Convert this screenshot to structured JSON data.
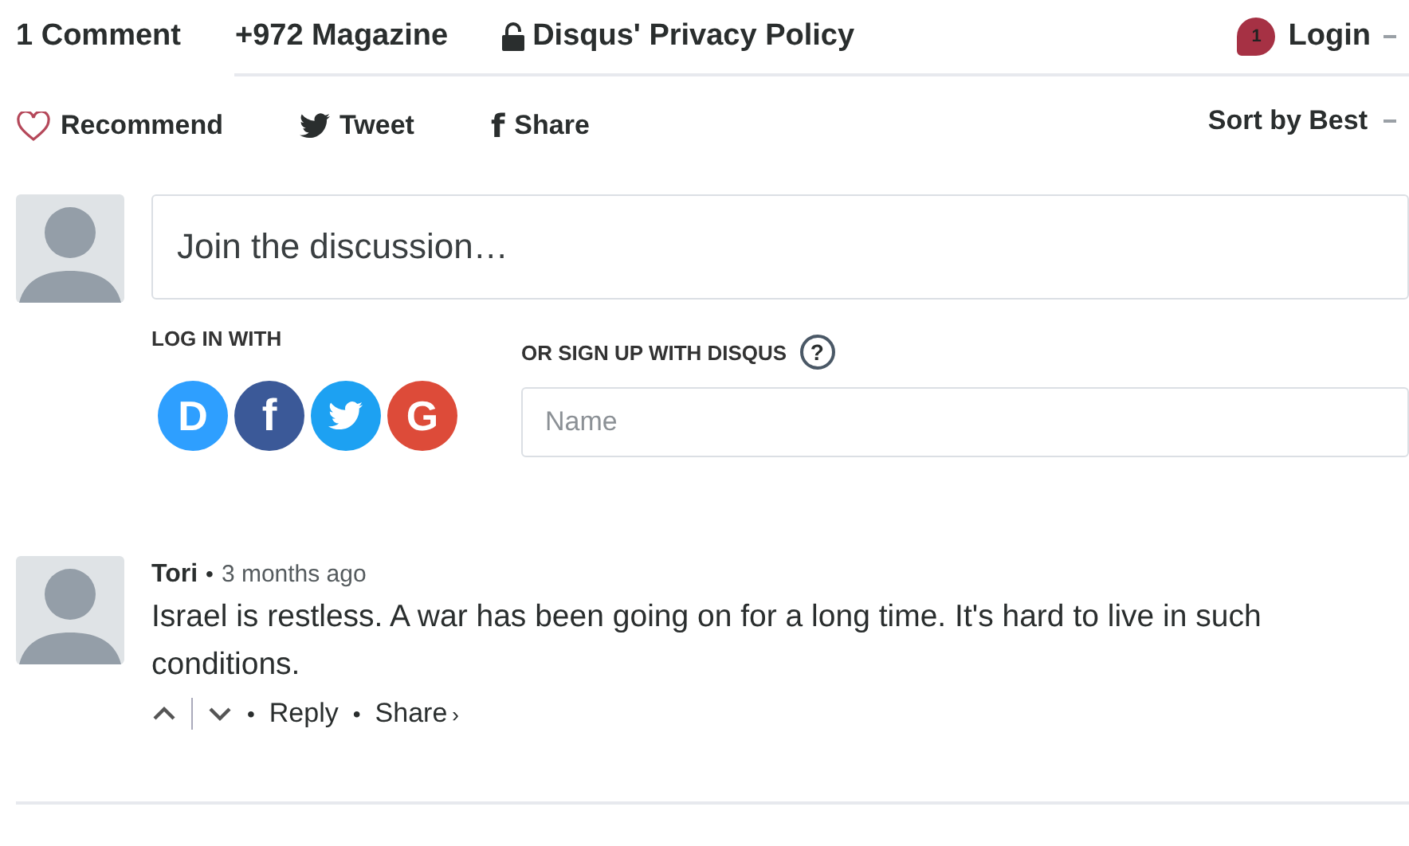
{
  "nav": {
    "tabs": [
      {
        "label": "1 Comment",
        "selected": true,
        "kind": "plain"
      },
      {
        "label": "+972 Magazine",
        "selected": false,
        "kind": "plain"
      },
      {
        "label": "Disqus' Privacy Policy",
        "selected": false,
        "kind": "locked"
      }
    ],
    "notification_count": "1",
    "login": "Login"
  },
  "toolbar": {
    "recommend": "Recommend",
    "tweet": "Tweet",
    "share_glyph": "f",
    "share": "Share",
    "sort": "Sort by Best"
  },
  "composer": {
    "placeholder": "Join the discussion…",
    "login_label": "LOG IN WITH",
    "providers": [
      {
        "kind": "disqus",
        "glyph": "D",
        "color": "#2e9fff"
      },
      {
        "kind": "facebook",
        "glyph": "f",
        "color": "#3b5998"
      },
      {
        "kind": "twitter",
        "color": "#1da1f2"
      },
      {
        "kind": "google",
        "glyph": "G",
        "color": "#dd4b39"
      }
    ],
    "signup_label": "OR SIGN UP WITH DISQUS",
    "help": "?",
    "name_placeholder": "Name"
  },
  "comments": [
    {
      "author": "Tori",
      "separator": "•",
      "time": "3 months ago",
      "text": "Israel is restless. A war has been going on for a long time. It's hard to live in such conditions.",
      "reply": "Reply",
      "share": "Share",
      "share_caret": "›"
    }
  ]
}
